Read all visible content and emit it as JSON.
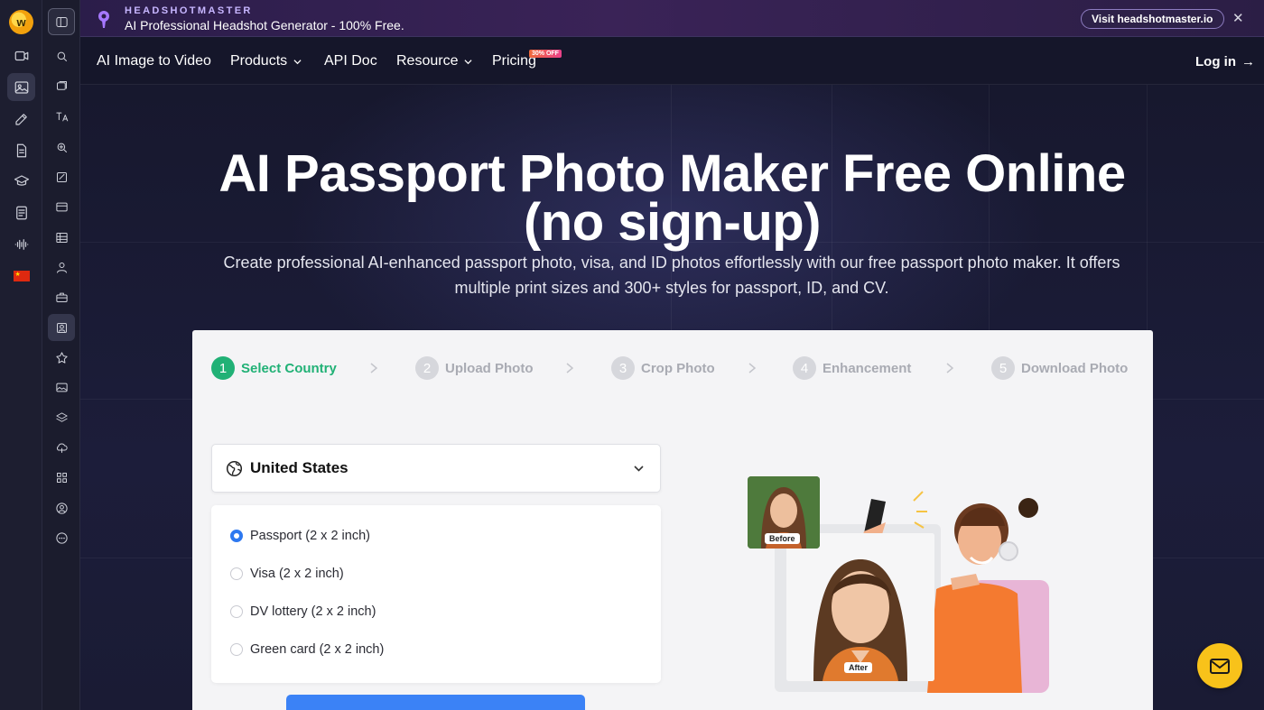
{
  "banner": {
    "brand": "HEADSHOTMASTER",
    "tagline": "AI Professional Headshot Generator - 100% Free.",
    "visit_label": "Visit headshotmaster.io",
    "close_glyph": "✕"
  },
  "nav": {
    "items": [
      {
        "label": "AI Image to Video",
        "dropdown": false
      },
      {
        "label": "Products",
        "dropdown": true
      },
      {
        "label": "API Doc",
        "dropdown": false
      },
      {
        "label": "Resource",
        "dropdown": true
      },
      {
        "label": "Pricing",
        "dropdown": false
      }
    ],
    "pricing_badge": "30% OFF",
    "login_label": "Log in",
    "login_arrow": "→"
  },
  "hero": {
    "title_line1": "AI Passport Photo Maker Free Online",
    "title_line2": "(no sign-up)",
    "subtitle": "Create professional AI-enhanced passport photo, visa, and ID photos effortlessly with our free passport photo maker. It offers multiple print sizes and 300+ styles for passport, ID, and CV."
  },
  "steps": [
    {
      "num": "1",
      "label": "Select Country",
      "active": true
    },
    {
      "num": "2",
      "label": "Upload Photo",
      "active": false
    },
    {
      "num": "3",
      "label": "Crop Photo",
      "active": false
    },
    {
      "num": "4",
      "label": "Enhancement",
      "active": false
    },
    {
      "num": "5",
      "label": "Download Photo",
      "active": false
    }
  ],
  "country": {
    "selected": "United States"
  },
  "document_options": [
    {
      "label": "Passport (2 x 2 inch)",
      "checked": true
    },
    {
      "label": "Visa (2 x 2 inch)",
      "checked": false
    },
    {
      "label": "DV lottery (2 x 2 inch)",
      "checked": false
    },
    {
      "label": "Green card (2 x 2 inch)",
      "checked": false
    }
  ],
  "illustration": {
    "before_label": "Before",
    "after_label": "After"
  },
  "colors": {
    "accent_green": "#21b176",
    "primary_blue": "#3b82f6",
    "fab_yellow": "#f8c21a",
    "hero_bg": "#17182e"
  },
  "icons": {
    "rail_primary": [
      "video-icon",
      "image-icon",
      "edit-icon",
      "document-icon",
      "graduation-icon",
      "notes-icon",
      "audio-wave-icon",
      "china-flag-icon"
    ],
    "rail_secondary": [
      "sidebar-toggle-icon",
      "search-icon",
      "layers-icon",
      "translate-icon",
      "zoom-icon",
      "check-square-icon",
      "card-icon",
      "table-icon",
      "person-icon",
      "toolbox-icon",
      "portrait-icon",
      "star-icon",
      "photo-icon",
      "stack-icon",
      "cloud-icon",
      "apps-icon",
      "user-circle-icon",
      "more-icon"
    ]
  }
}
